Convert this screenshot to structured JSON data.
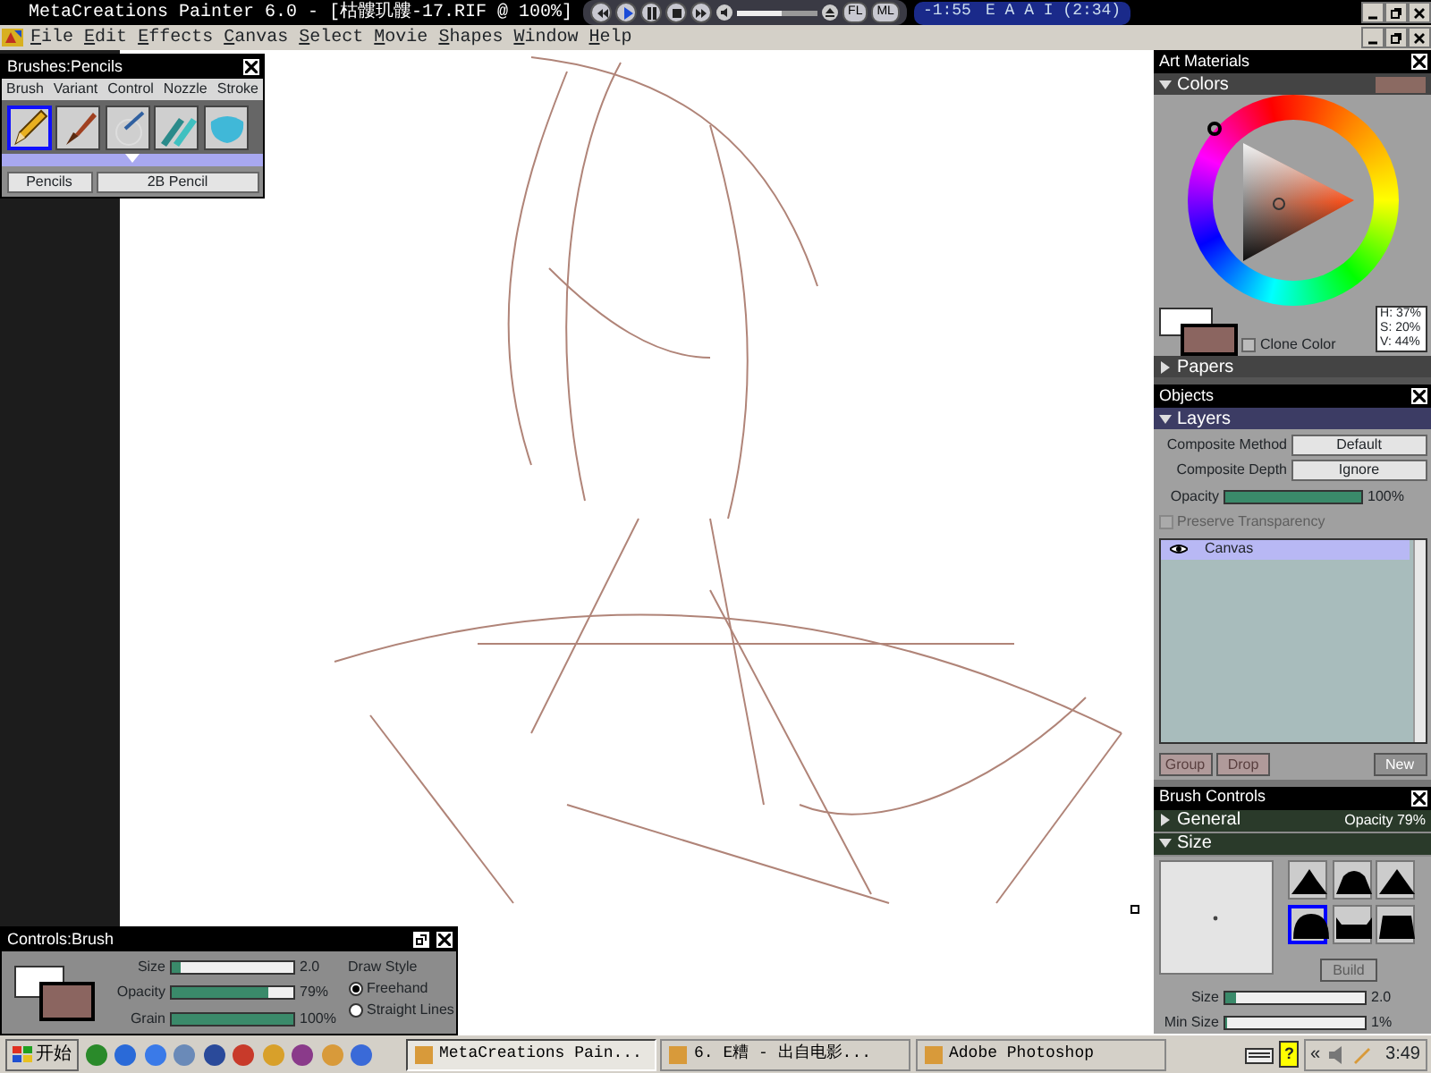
{
  "window": {
    "title": "MetaCreations Painter 6.0 - [枯髏玑髏-17.RIF @ 100%]"
  },
  "media_player": {
    "buttons": [
      {
        "kind": "previous"
      },
      {
        "kind": "play"
      },
      {
        "kind": "pause"
      },
      {
        "kind": "stop"
      },
      {
        "kind": "next"
      }
    ],
    "volume": {
      "level": 0.55
    },
    "mode_buttons": [
      "FL",
      "ML"
    ],
    "time": "-1:55",
    "track": "E A A I  (2:34)"
  },
  "menu": [
    "File",
    "Edit",
    "Effects",
    "Canvas",
    "Select",
    "Movie",
    "Shapes",
    "Window",
    "Help"
  ],
  "brushes_palette": {
    "title": "Brushes:Pencils",
    "tabs": [
      "Brush",
      "Variant",
      "Control",
      "Nozzle",
      "Stroke"
    ],
    "brushes": [
      {
        "kind": "pencil",
        "selected": true
      },
      {
        "kind": "brush",
        "selected": false
      },
      {
        "kind": "airbrush",
        "selected": false
      },
      {
        "kind": "marker",
        "selected": false
      },
      {
        "kind": "smear",
        "selected": false
      }
    ],
    "category": "Pencils",
    "variant": "2B Pencil"
  },
  "art_materials": {
    "title": "Art Materials",
    "sections": [
      {
        "label": "Colors",
        "expanded": true
      },
      {
        "label": "Papers",
        "expanded": false
      }
    ],
    "hsv": [
      "H: 37%",
      "S: 20%",
      "V: 44%"
    ],
    "clone_color": {
      "label": "Clone Color",
      "checked": false
    }
  },
  "objects": {
    "title": "Objects",
    "section": {
      "label": "Layers",
      "expanded": true
    },
    "fields": [
      {
        "label": "Composite Method",
        "value": "Default"
      },
      {
        "label": "Composite Depth",
        "value": "Ignore"
      }
    ],
    "opacity": {
      "label": "Opacity",
      "level": 1.0,
      "reading": "100%"
    },
    "preserve": {
      "label": "Preserve Transparency",
      "checked": false,
      "disabled": true
    },
    "layers": [
      {
        "name": "Canvas",
        "selected": true
      }
    ],
    "buttons": [
      {
        "label": "Group",
        "disabled": true
      },
      {
        "label": "Drop",
        "disabled": true
      },
      {
        "label": "New",
        "disabled": false
      }
    ]
  },
  "brush_controls": {
    "title": "Brush Controls",
    "sections": [
      {
        "label": "General",
        "expanded": false,
        "info": "Opacity 79%"
      },
      {
        "label": "Size",
        "expanded": true
      }
    ],
    "profiles": [
      {
        "kind": "pointed",
        "selected": false
      },
      {
        "kind": "medium",
        "selected": false
      },
      {
        "kind": "linear",
        "selected": false
      },
      {
        "kind": "dull",
        "selected": true
      },
      {
        "kind": "watercolor",
        "selected": false
      },
      {
        "kind": "flat",
        "selected": false
      }
    ],
    "build": {
      "label": "Build",
      "disabled": true
    },
    "sliders": [
      {
        "label": "Size",
        "level": 0.08,
        "reading": "2.0"
      },
      {
        "label": "Min Size",
        "level": 0.01,
        "reading": "1%"
      }
    ]
  },
  "controls_brush": {
    "title": "Controls:Brush",
    "sliders": [
      {
        "label": "Size",
        "level": 0.08,
        "reading": "2.0"
      },
      {
        "label": "Opacity",
        "level": 0.79,
        "reading": "79%"
      },
      {
        "label": "Grain",
        "level": 1.0,
        "reading": "100%"
      }
    ],
    "draw_style": {
      "label": "Draw Style",
      "options": [
        {
          "label": "Freehand",
          "selected": true
        },
        {
          "label": "Straight Lines",
          "selected": false
        }
      ]
    }
  },
  "taskbar": {
    "start": "开始",
    "quick_launch": [
      {
        "color": "#2a8a2a"
      },
      {
        "color": "#2a6ad8"
      },
      {
        "color": "#3a7ae8"
      },
      {
        "color": "#6a8ab8"
      },
      {
        "color": "#2a4a9a"
      },
      {
        "color": "#c83a2a"
      },
      {
        "color": "#d8a02a"
      },
      {
        "color": "#8a3a8a"
      },
      {
        "color": "#d89a3a"
      },
      {
        "color": "#3a6ad8"
      }
    ],
    "tasks": [
      {
        "label": "MetaCreations Pain...",
        "selected": true
      },
      {
        "label": "6. E糟 - 出自电影...",
        "selected": false
      },
      {
        "label": "Adobe Photoshop",
        "selected": false
      }
    ],
    "tray": {
      "expander": "«",
      "help": "?",
      "clock": "3:49"
    }
  }
}
